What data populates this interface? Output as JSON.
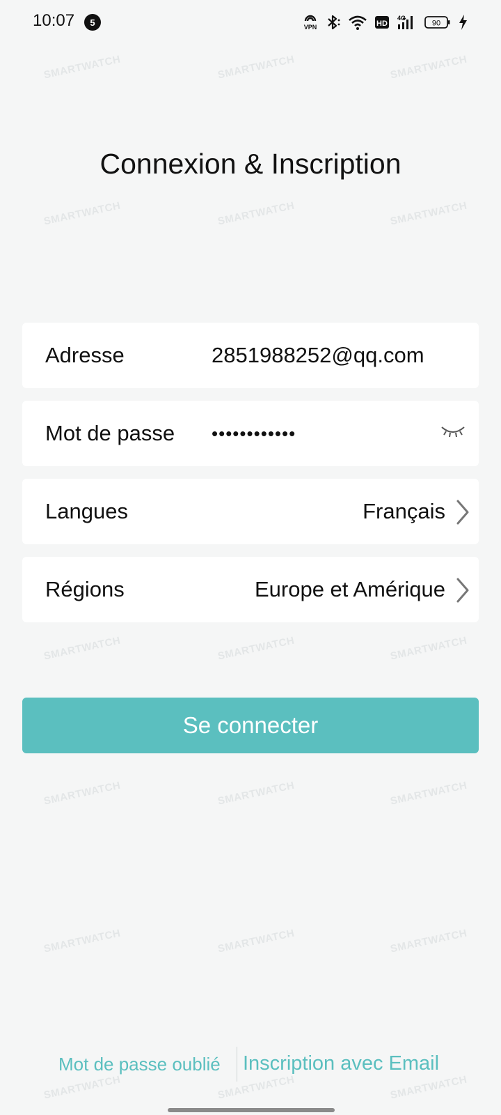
{
  "status_bar": {
    "time": "10:07",
    "notification_count": "5",
    "battery_level": "90",
    "icons": [
      "vpn-icon",
      "bluetooth-icon",
      "wifi-icon",
      "hd-icon",
      "4g-signal-icon",
      "battery-icon",
      "charging-icon"
    ]
  },
  "watermark_text": "SMARTWATCH",
  "page": {
    "title": "Connexion & Inscription"
  },
  "form": {
    "email": {
      "label": "Adresse",
      "value": "2851988252@qq.com"
    },
    "password": {
      "label": "Mot de passe",
      "value": "••••••••••••",
      "toggle_icon": "eye-closed-icon"
    },
    "language": {
      "label": "Langues",
      "value": "Français",
      "icon": "chevron-right-icon"
    },
    "region": {
      "label": "Régions",
      "value": "Europe et Amérique",
      "icon": "chevron-right-icon"
    }
  },
  "actions": {
    "login_label": "Se connecter",
    "forgot_password_label": "Mot de passe oublié",
    "register_label": "Inscription avec Email"
  },
  "colors": {
    "accent": "#5bbfbf",
    "background": "#f5f6f6",
    "card": "#ffffff",
    "text": "#111111"
  }
}
